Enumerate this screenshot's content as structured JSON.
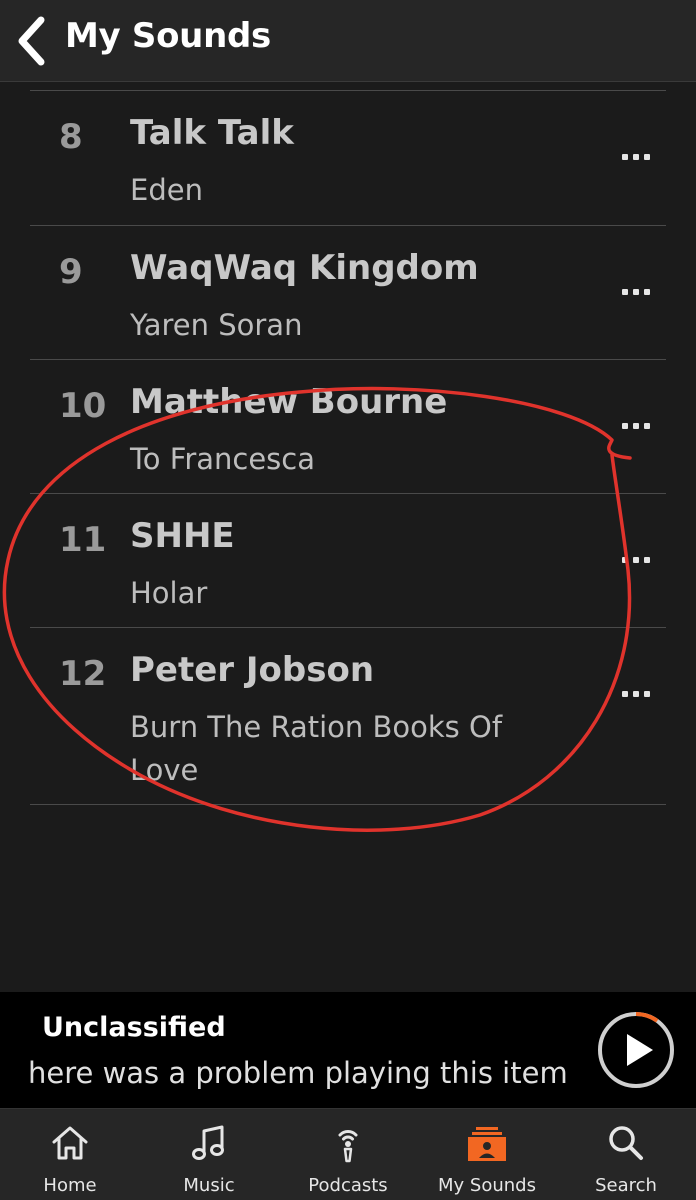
{
  "header": {
    "title": "My Sounds"
  },
  "tracks": [
    {
      "number": "8",
      "artist": "Talk Talk",
      "title": "Eden"
    },
    {
      "number": "9",
      "artist": "WaqWaq Kingdom",
      "title": "Yaren Soran"
    },
    {
      "number": "10",
      "artist": "Matthew Bourne",
      "title": "To Francesca"
    },
    {
      "number": "11",
      "artist": "SHHE",
      "title": "Holar"
    },
    {
      "number": "12",
      "artist": "Peter Jobson",
      "title": "Burn The Ration Books Of Love"
    }
  ],
  "player": {
    "title": "Unclassified",
    "status": "here was a problem playing this item",
    "progress": 0.1
  },
  "tabs": [
    {
      "label": "Home",
      "icon": "home-icon"
    },
    {
      "label": "Music",
      "icon": "music-note-icon"
    },
    {
      "label": "Podcasts",
      "icon": "podcast-icon"
    },
    {
      "label": "My Sounds",
      "icon": "my-sounds-icon",
      "active": true
    },
    {
      "label": "Search",
      "icon": "search-icon"
    }
  ],
  "colors": {
    "accent": "#f26722",
    "annotation": "#e0332c",
    "background": "#1b1b1b"
  }
}
